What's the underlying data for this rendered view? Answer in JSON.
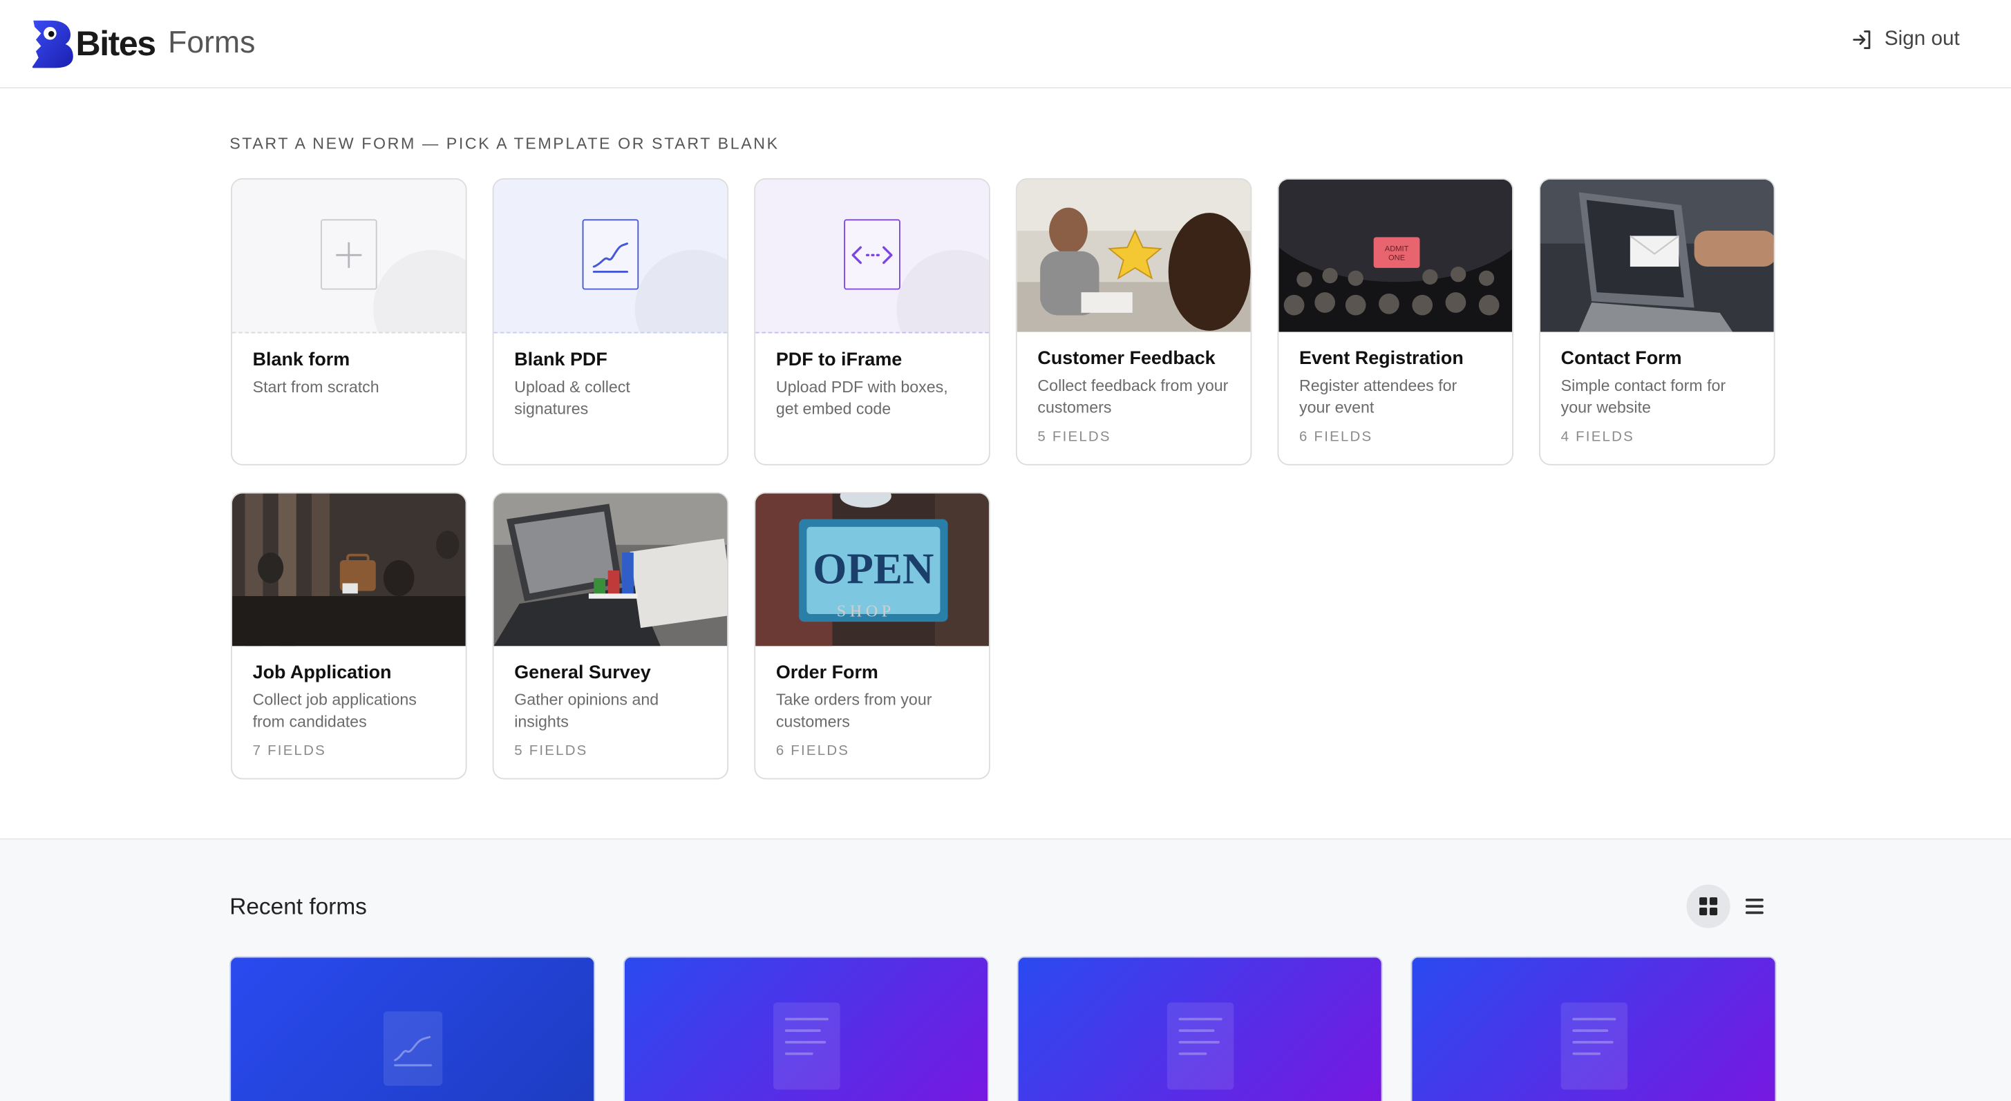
{
  "header": {
    "brand_name": "Bites",
    "brand_sub": "Forms",
    "sign_out_label": "Sign out"
  },
  "templates": {
    "section_label": "START A NEW FORM — PICK A TEMPLATE OR START BLANK",
    "items": [
      {
        "title": "Blank form",
        "desc": "Start from scratch",
        "fields": ""
      },
      {
        "title": "Blank PDF",
        "desc": "Upload & collect signatures",
        "fields": ""
      },
      {
        "title": "PDF to iFrame",
        "desc": "Upload PDF with boxes, get embed code",
        "fields": ""
      },
      {
        "title": "Customer Feedback",
        "desc": "Collect feedback from your customers",
        "fields": "5 FIELDS"
      },
      {
        "title": "Event Registration",
        "desc": "Register attendees for your event",
        "fields": "6 FIELDS"
      },
      {
        "title": "Contact Form",
        "desc": "Simple contact form for your website",
        "fields": "4 FIELDS"
      },
      {
        "title": "Job Application",
        "desc": "Collect job applications from candidates",
        "fields": "7 FIELDS"
      },
      {
        "title": "General Survey",
        "desc": "Gather opinions and insights",
        "fields": "5 FIELDS"
      },
      {
        "title": "Order Form",
        "desc": "Take orders from your customers",
        "fields": "6 FIELDS"
      }
    ],
    "image_labels": {
      "ticket_line1": "ADMIT",
      "ticket_line2": "ONE",
      "sign_word": "OPEN",
      "sign_sub": "SHOP"
    }
  },
  "recent": {
    "title": "Recent forms",
    "view_grid_icon": "grid-icon",
    "view_list_icon": "list-icon"
  },
  "colors": {
    "brand": "#2a3be0",
    "accent_blue": "#3b52d4",
    "accent_purple": "#7b46e0",
    "recent_gradient_start": "#2a4af0",
    "recent_gradient_end": "#7a16e0"
  }
}
